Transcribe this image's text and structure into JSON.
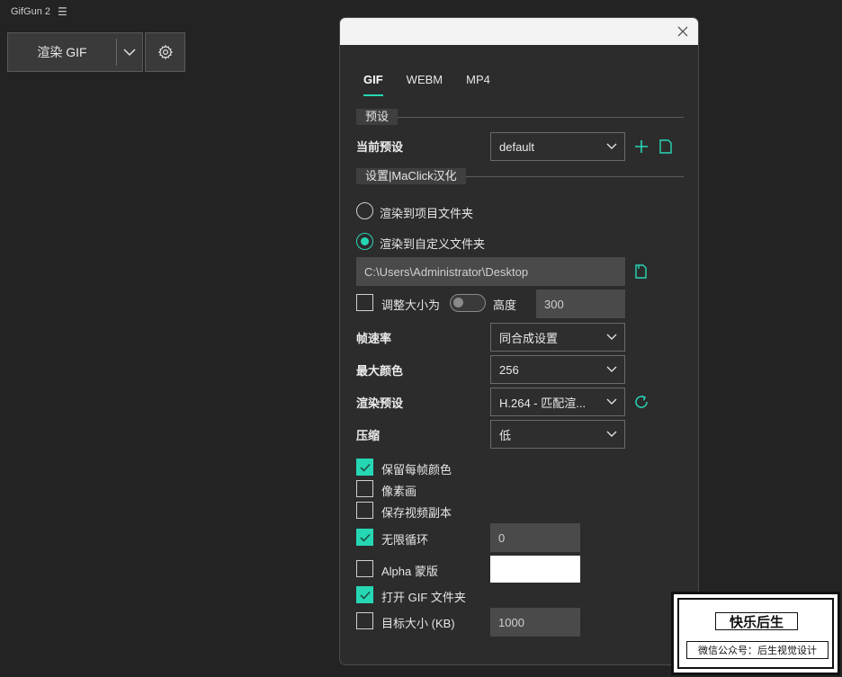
{
  "panel": {
    "title": "GifGun 2",
    "menu_icon": "hamburger-icon",
    "render_label": "渲染 GIF"
  },
  "tabs": [
    {
      "label": "GIF",
      "active": true
    },
    {
      "label": "WEBM",
      "active": false
    },
    {
      "label": "MP4",
      "active": false
    }
  ],
  "preset_section": {
    "title": "预设",
    "current_label": "当前预设",
    "current_value": "default"
  },
  "settings_section": {
    "title": "设置|MaClick汉化",
    "radio_project": "渲染到项目文件夹",
    "radio_custom": "渲染到自定义文件夹",
    "radio_selected": "custom",
    "path_value": "C:\\Users\\Administrator\\Desktop",
    "resize_label": "调整大小为",
    "resize_checked": false,
    "height_label": "高度",
    "height_value": "300",
    "fps_label": "帧速率",
    "fps_value": "同合成设置",
    "maxcolors_label": "最大颜色",
    "maxcolors_value": "256",
    "render_preset_label": "渲染预设",
    "render_preset_value": "H.264 - 匹配渲...",
    "compress_label": "压缩",
    "compress_value": "低",
    "keep_colors_label": "保留每帧颜色",
    "keep_colors_checked": true,
    "pixel_art_label": "像素画",
    "pixel_art_checked": false,
    "save_video_copy_label": "保存视频副本",
    "save_video_copy_checked": false,
    "infinite_loop_label": "无限循环",
    "infinite_loop_checked": true,
    "loop_value": "0",
    "alpha_matte_label": "Alpha 蒙版",
    "alpha_matte_checked": false,
    "alpha_color": "#ffffff",
    "open_folder_label": "打开 GIF 文件夹",
    "open_folder_checked": true,
    "target_size_label": "目标大小 (KB)",
    "target_size_checked": false,
    "target_size_value": "1000"
  },
  "colors": {
    "accent": "#26d7b4",
    "background": "#232323",
    "dialog_bg": "#2c2c2c"
  },
  "stamp": {
    "title": "快乐后生",
    "subtitle": "微信公众号：后生视觉设计"
  }
}
